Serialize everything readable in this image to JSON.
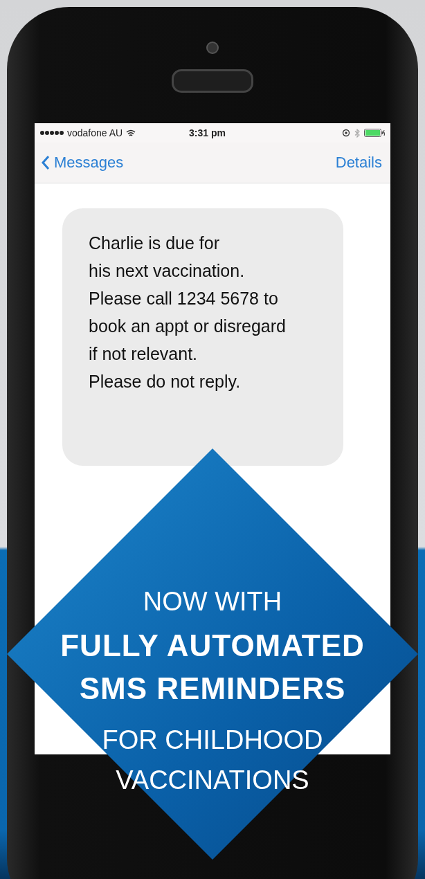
{
  "status_bar": {
    "carrier": "vodafone AU",
    "time": "3:31 pm"
  },
  "nav_bar": {
    "back_label": "Messages",
    "action": "Details"
  },
  "message": {
    "lines": [
      "Charlie is due for",
      "his next vaccination.",
      "Please call 1234 5678 to",
      "book an appt or disregard",
      "if not relevant.",
      "Please do not reply."
    ]
  },
  "banner": {
    "lines": [
      {
        "kind": "light",
        "text": "NOW WITH"
      },
      {
        "kind": "bold",
        "text": "FULLY AUTOMATED"
      },
      {
        "kind": "bold",
        "text": "SMS REMINDERS"
      },
      {
        "kind": "light",
        "text": "FOR CHILDHOOD"
      },
      {
        "kind": "light",
        "text": "VACCINATIONS"
      }
    ]
  }
}
